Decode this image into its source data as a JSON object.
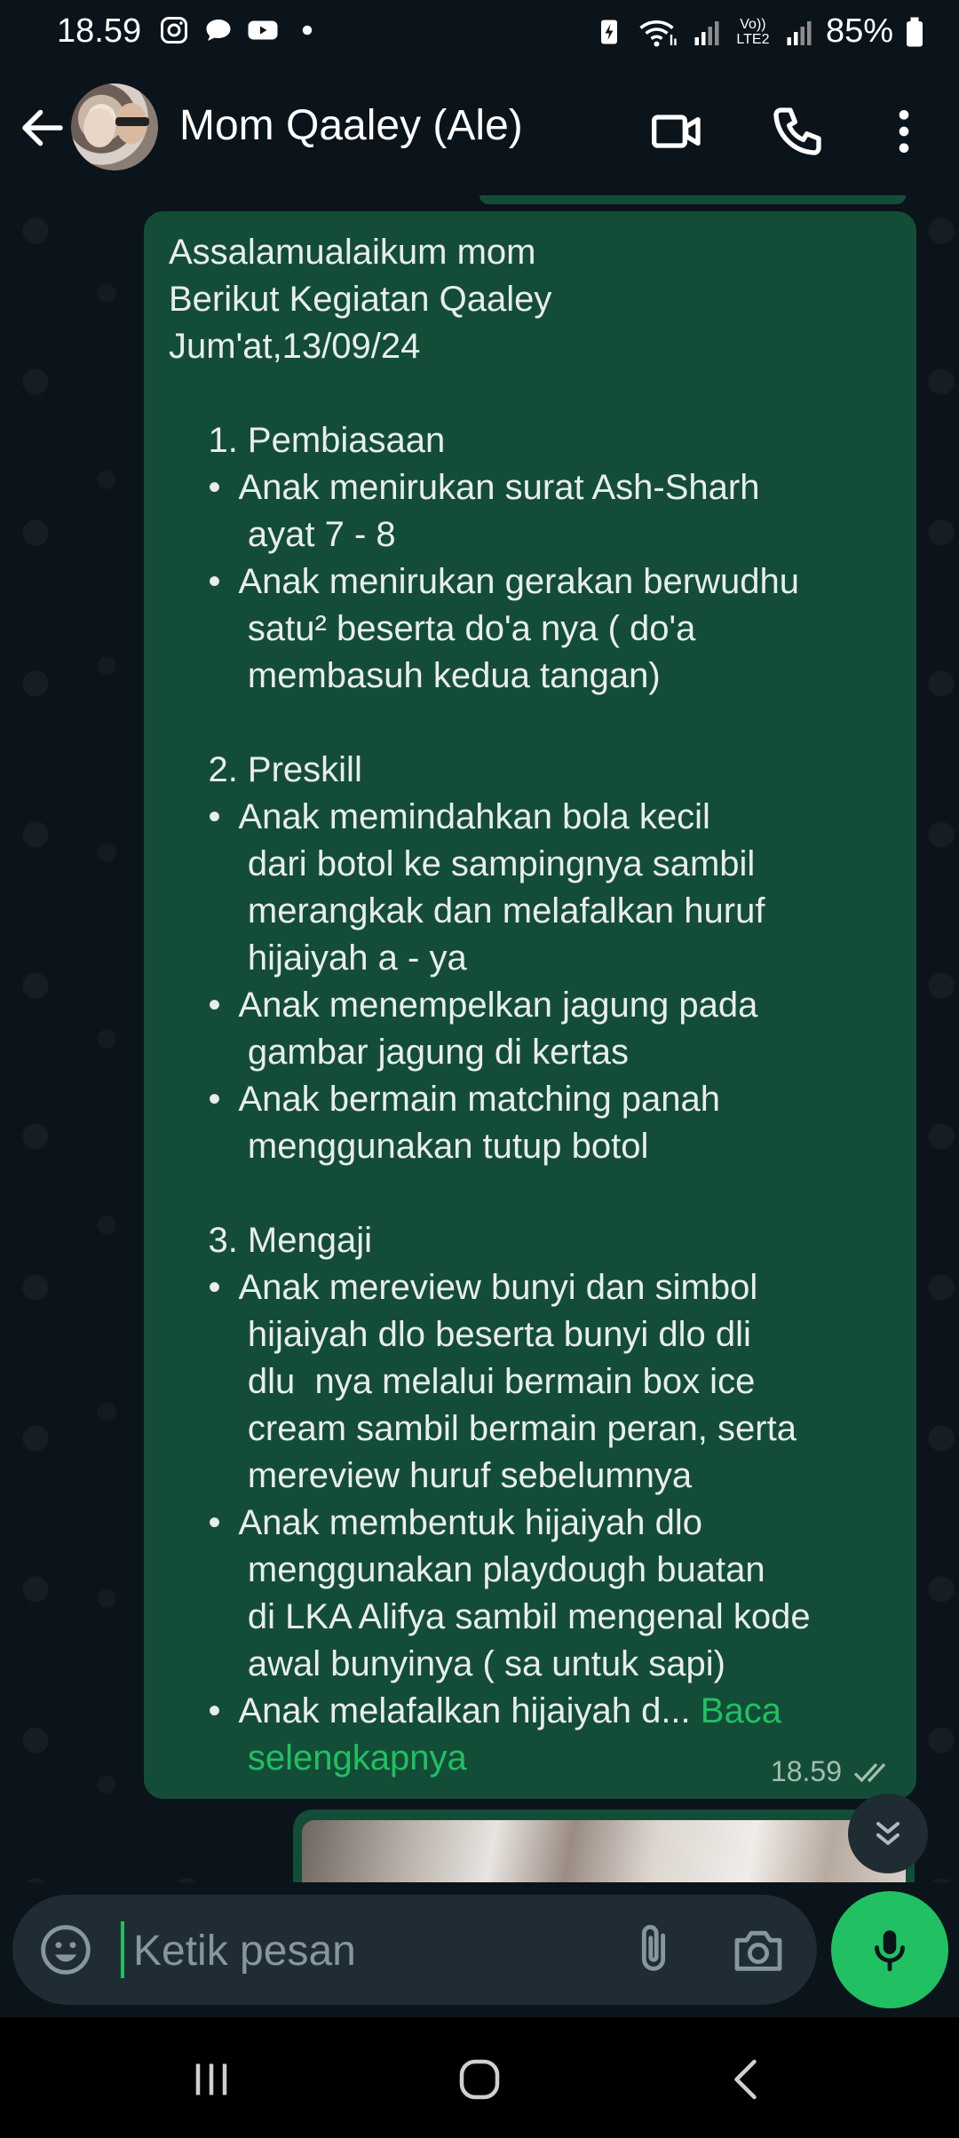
{
  "status_bar": {
    "time": "18.59",
    "battery": "85%",
    "network_label": "Vo)) LTE2",
    "notification_icons": [
      "instagram-icon",
      "message-bubble-icon",
      "youtube-icon",
      "dot-icon"
    ]
  },
  "header": {
    "contact_name": "Mom Qaaley (Ale)",
    "actions": [
      "video-call-icon",
      "voice-call-icon",
      "more-options-icon"
    ]
  },
  "message": {
    "body": "Assalamualaikum mom\nBerikut Kegiatan Qaaley\nJum'at,13/09/24\n\n    1. Pembiasaan\n    •  Anak menirukan surat Ash-Sharh\n        ayat 7 - 8\n    •  Anak menirukan gerakan berwudhu\n        satu² beserta do'a nya ( do'a\n        membasuh kedua tangan)\n\n    2. Preskill\n    •  Anak memindahkan bola kecil\n        dari botol ke sampingnya sambil\n        merangkak dan melafalkan huruf\n        hijaiyah a - ya\n    •  Anak menempelkan jagung pada\n        gambar jagung di kertas\n    •  Anak bermain matching panah\n        menggunakan tutup botol\n\n    3. Mengaji\n    •  Anak mereview bunyi dan simbol\n        hijaiyah dlo beserta bunyi dlo dli\n        dlu  nya melalui bermain box ice\n        cream sambil bermain peran, serta\n        mereview huruf sebelumnya\n    •  Anak membentuk hijaiyah dlo\n        menggunakan playdough buatan\n        di LKA Alifya sambil mengenal kode\n        awal bunyinya ( sa untuk sapi)\n    •  Anak melafalkan hijaiyah d... ",
    "read_more_label": "Baca\n        selengkapnya",
    "time": "18.59",
    "status": "read"
  },
  "input": {
    "placeholder": "Ketik pesan"
  },
  "colors": {
    "background": "#0b141a",
    "bubble_outgoing": "#144d37",
    "accent": "#21c063",
    "input_bg": "#202c33"
  },
  "nav": {
    "buttons": [
      "recent-apps-icon",
      "home-icon",
      "back-icon"
    ]
  }
}
